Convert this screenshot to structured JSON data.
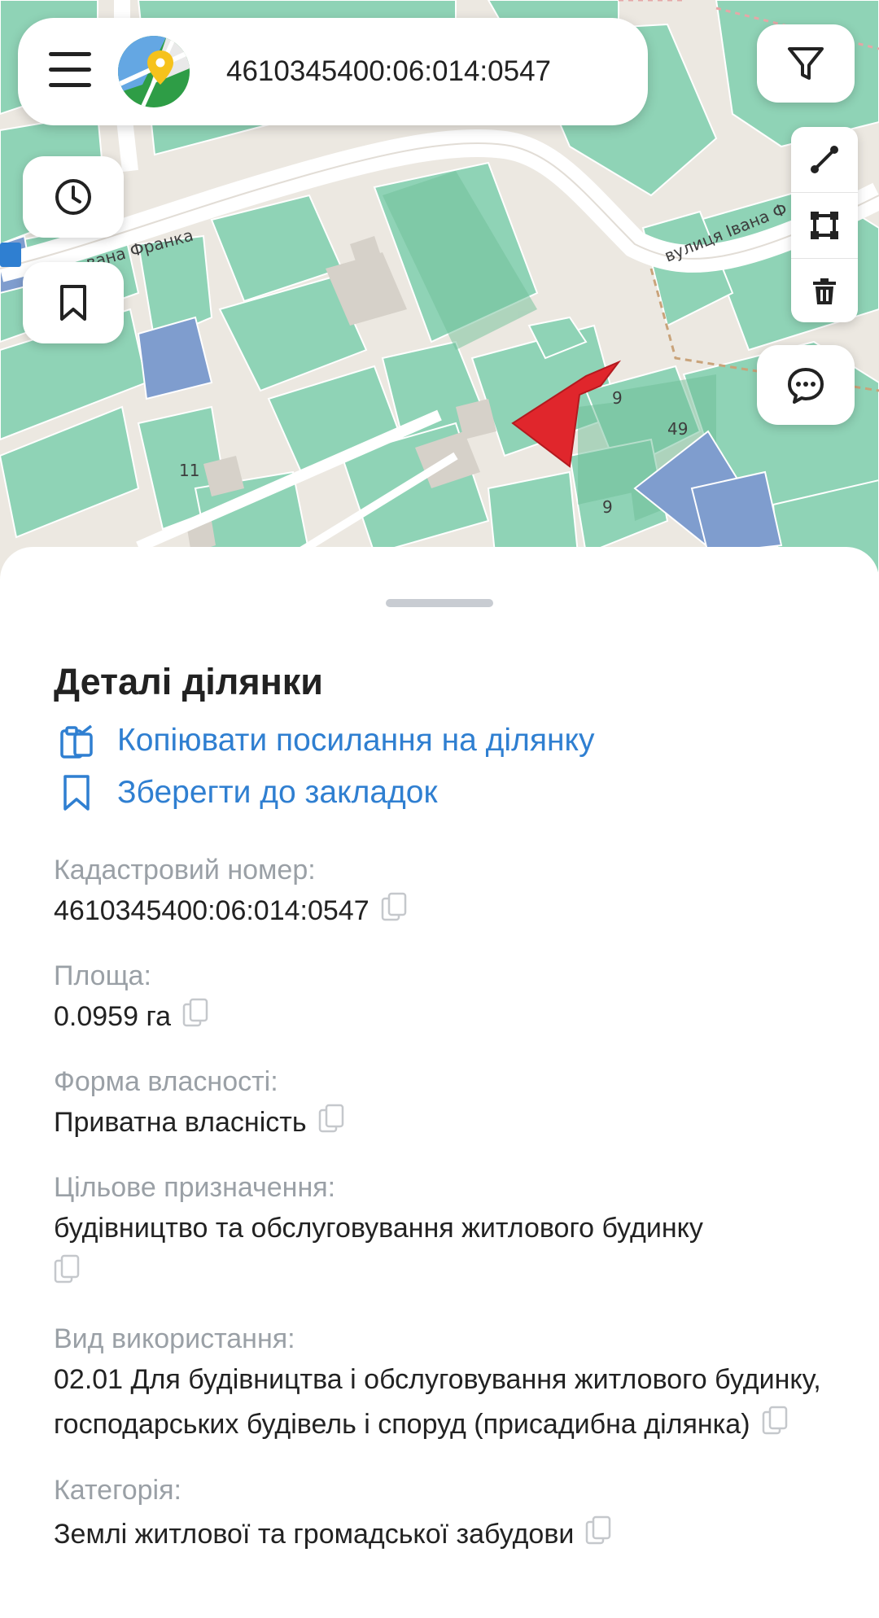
{
  "map": {
    "street_left": "вана Франка",
    "street_right": "вулиця Івана Ф",
    "house_numbers": [
      "11",
      "49",
      "9",
      "9"
    ]
  },
  "search": {
    "value": "4610345400:06:014:0547"
  },
  "icons": {
    "menu": "hamburger-icon",
    "logo": "map-pin-logo",
    "filter": "filter-funnel-icon",
    "history": "clock-icon",
    "bookmark": "bookmark-icon",
    "line_tool": "draw-line-icon",
    "polygon_tool": "draw-polygon-icon",
    "trash": "trash-icon",
    "chat": "chat-bubble-icon",
    "copy": "copy-icon"
  },
  "colors": {
    "accent": "#2f7fd1",
    "selected_parcel": "#e0262c",
    "parcel_green": "#8fd3b6",
    "parcel_blue": "#7f9dce"
  },
  "details": {
    "title": "Деталі ділянки",
    "copy_link_label": "Копіювати посилання на ділянку",
    "save_link_label": "Зберегти до закладок",
    "fields": [
      {
        "label": "Кадастровий номер:",
        "value": "4610345400:06:014:0547"
      },
      {
        "label": "Площа:",
        "value": "0.0959 га"
      },
      {
        "label": "Форма власності:",
        "value": "Приватна власність"
      },
      {
        "label": "Цільове призначення:",
        "value": "будівництво та обслуговування житлового будинку"
      },
      {
        "label": "Вид використання:",
        "value": "02.01 Для будівництва і обслуговування житлового будинку, господарських будівель і споруд (присадибна ділянка)"
      },
      {
        "label": "Категорія:",
        "value": "Землі житлової та громадської забудови"
      }
    ]
  }
}
